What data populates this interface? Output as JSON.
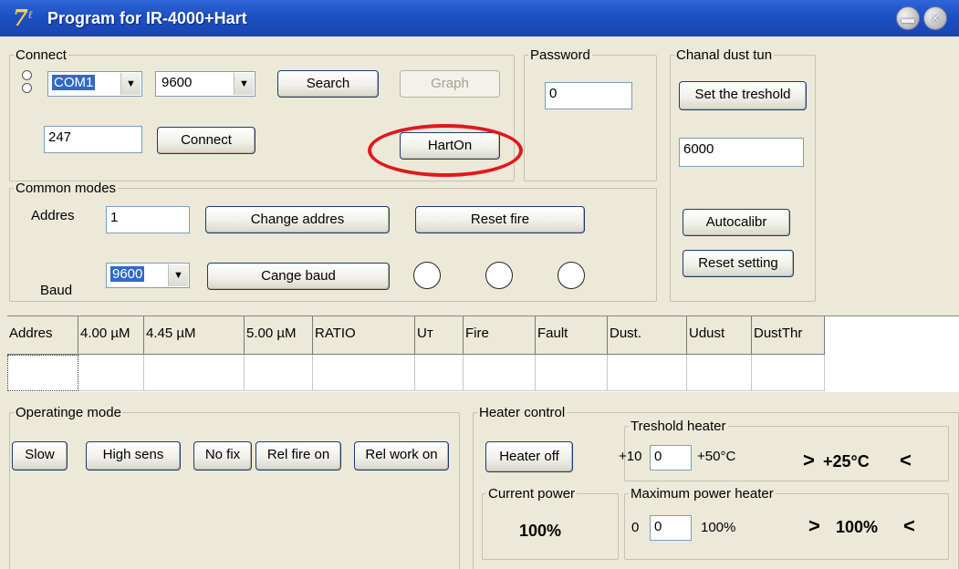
{
  "window": {
    "title": "Program for IR-4000+Hart",
    "icon": "app-logo-icon",
    "controls": [
      "minimize-icon",
      "close-icon"
    ]
  },
  "connect": {
    "legend": "Connect",
    "port": "COM1",
    "baud": "9600",
    "search_label": "Search",
    "graph_label": "Graph",
    "address": "247",
    "connect_label": "Connect",
    "harton_label": "HartOn"
  },
  "password": {
    "legend": "Password",
    "value": "0"
  },
  "chanal": {
    "legend": "Chanal dust tun",
    "set_threshold_label": "Set the treshold",
    "threshold_value": "6000",
    "autocalibr_label": "Autocalibr",
    "reset_setting_label": "Reset setting"
  },
  "common": {
    "legend": "Common modes",
    "addres_label": "Addres",
    "addres_value": "1",
    "change_addres_label": "Change addres",
    "reset_fire_label": "Reset fire",
    "baud_label": "Baud",
    "baud_value": "9600",
    "change_baud_label": "Cange baud"
  },
  "table": {
    "columns": [
      "Addres",
      "4.00 µM",
      "4.45 µM",
      "5.00 µM",
      "RATIO",
      "Uт",
      "Fire",
      "Fault",
      "Dust.",
      "Udust",
      "DustThr"
    ],
    "rows": [
      [
        "",
        "",
        "",
        "",
        "",
        "",
        "",
        "",
        "",
        "",
        ""
      ]
    ]
  },
  "operating": {
    "legend": "Operatinge mode",
    "slow_label": "Slow",
    "high_sens_label": "High sens",
    "no_fix_label": "No fix",
    "rel_fire_on_label": "Rel fire on",
    "rel_work_on_label": "Rel work on"
  },
  "heater": {
    "legend": "Heater control",
    "heater_off_label": "Heater off",
    "current_power_legend": "Current power",
    "current_power_value": "100%",
    "threshold_legend": "Treshold heater",
    "threshold_min": "+10",
    "threshold_value": "0",
    "threshold_max": "+50°C",
    "threshold_display_left": ">",
    "threshold_display_value": "+25°C",
    "threshold_display_right": "<",
    "max_power_legend": "Maximum power heater",
    "max_power_min": "0",
    "max_power_value": "0",
    "max_power_max": "100%",
    "max_power_display_left": ">",
    "max_power_display_value": "100%",
    "max_power_display_right": "<"
  },
  "colors": {
    "titlebar": "#1d4fc2",
    "client_bg": "#ece9d8",
    "highlight_ellipse": "#e0181e",
    "selection": "#316ac5"
  }
}
